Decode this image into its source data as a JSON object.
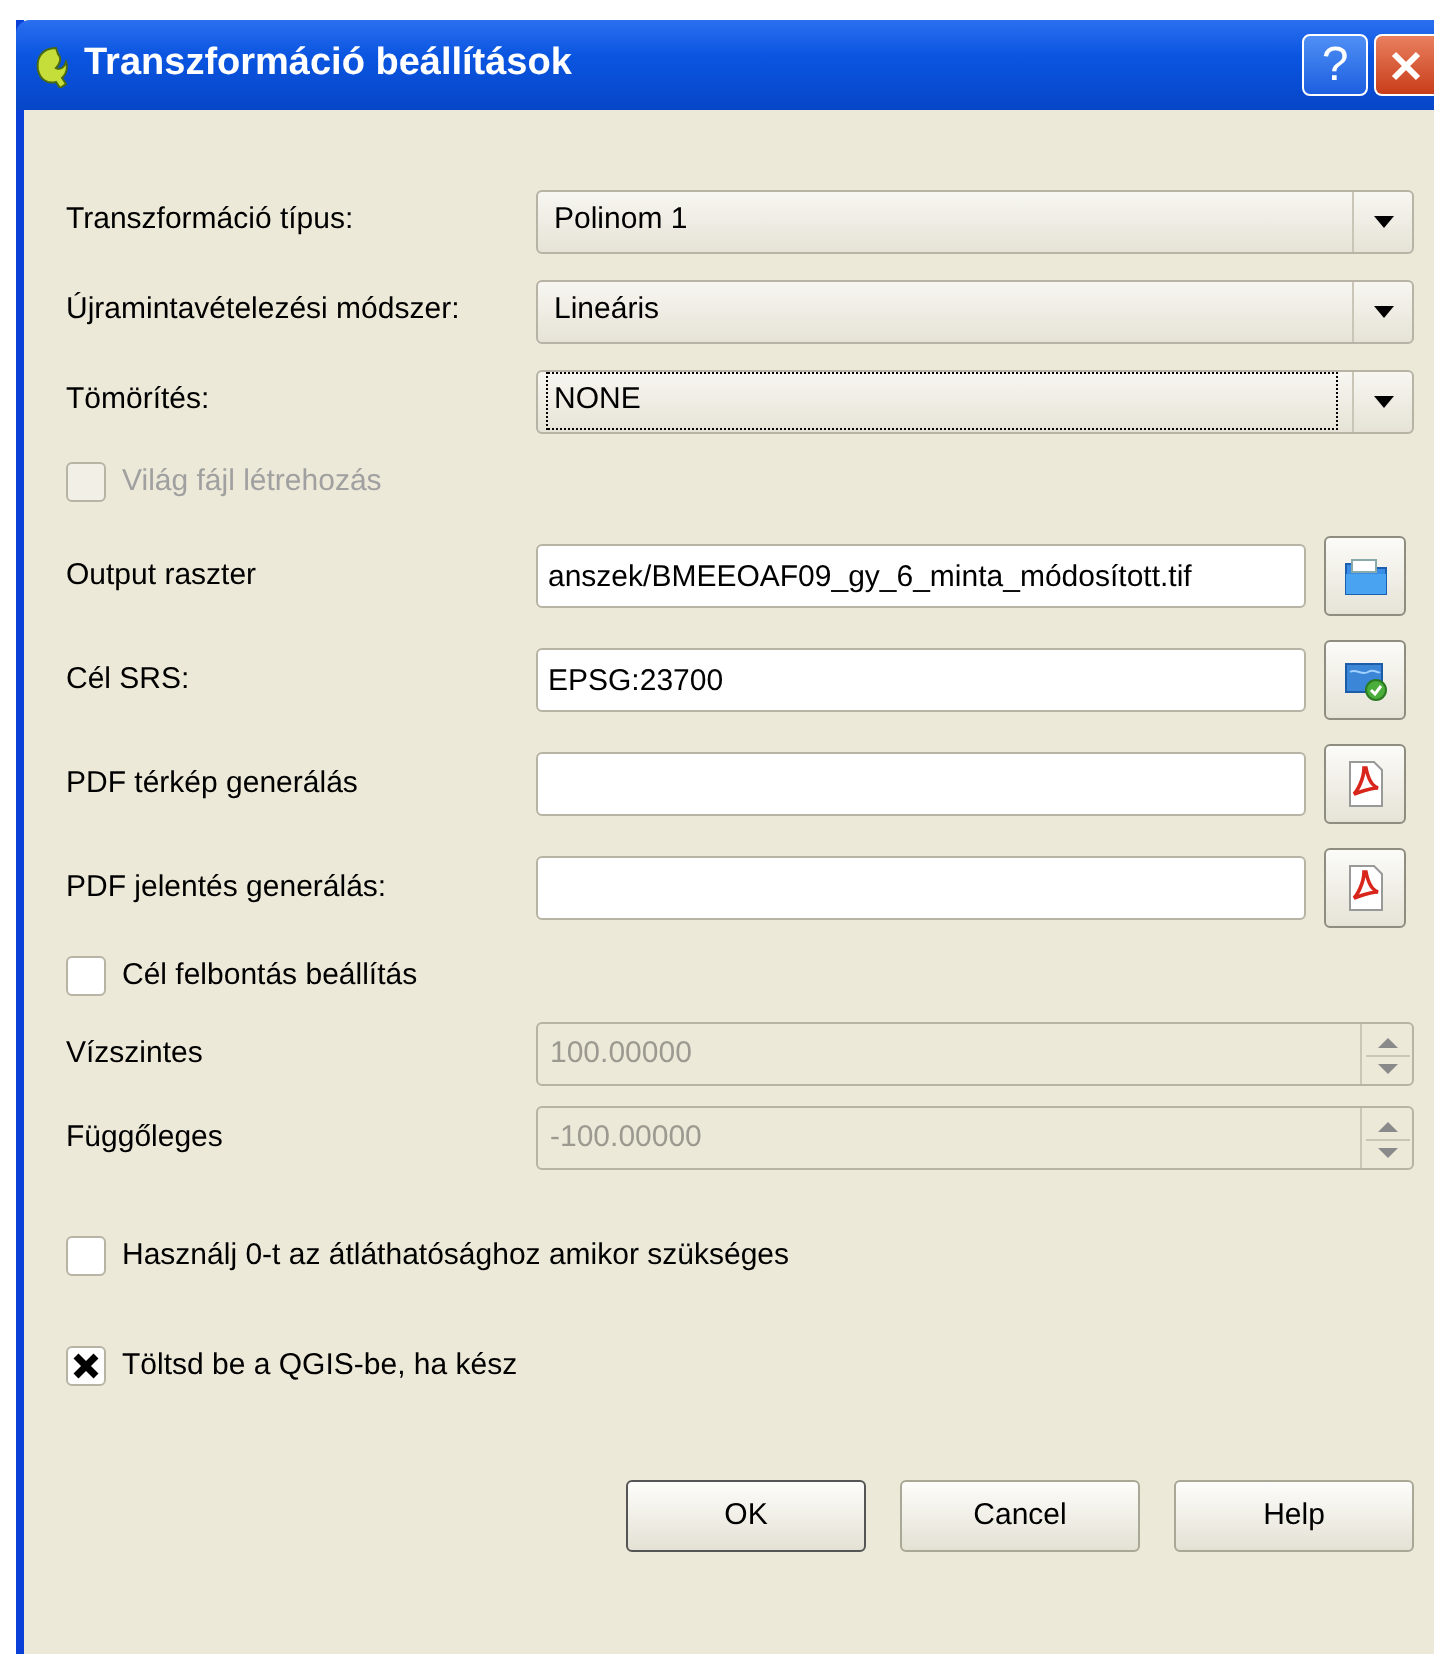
{
  "window": {
    "title": "Transzformáció beállítások"
  },
  "title_buttons": [
    {
      "kind": "help",
      "label": "?"
    },
    {
      "kind": "close"
    }
  ],
  "sections": [
    {
      "rows": [
        {
          "kind": "combo",
          "label": "Transzformáció típus:",
          "value": "Polinom 1",
          "focused": false
        },
        {
          "kind": "combo",
          "label": "Újramintavételezési módszer:",
          "value": "Lineáris",
          "focused": false
        },
        {
          "kind": "combo",
          "label": "Tömörítés:",
          "value": "NONE",
          "focused": true
        },
        {
          "kind": "checkbox",
          "label": "Világ fájl létrehozás",
          "checked": false,
          "disabled": true
        }
      ]
    },
    {
      "rows": [
        {
          "kind": "save",
          "label": "Output raszter",
          "value": "anszek/BMEEOAF09_gy_6_minta_módosított.tif"
        },
        {
          "kind": "crs",
          "label": "Cél SRS:",
          "value": "EPSG:23700"
        },
        {
          "kind": "pdf",
          "label": "PDF térkép generálás"
        },
        {
          "kind": "pdf",
          "label": "PDF jelentés generálás:"
        },
        {
          "kind": "checkbox",
          "label": "Cél felbontás beállítás",
          "checked": false,
          "disabled": false
        },
        {
          "kind": "spin",
          "label": "Vízszintes",
          "value": "100.00000",
          "disabled": true
        },
        {
          "kind": "spin",
          "label": "Függőleges",
          "value": "-100.00000",
          "disabled": true
        }
      ]
    },
    {
      "rows": [
        {
          "kind": "checkbox",
          "label": "Használj 0-t az átláthatósághoz amikor szükséges",
          "checked": false,
          "disabled": false
        }
      ]
    },
    {
      "rows": [
        {
          "kind": "checkbox",
          "label": "Töltsd be a QGIS-be, ha kész",
          "checked": true,
          "disabled": false
        }
      ]
    }
  ],
  "buttons": [
    {
      "label": "OK",
      "default": true
    },
    {
      "label": "Cancel",
      "default": false
    },
    {
      "label": "Help",
      "default": false
    }
  ]
}
